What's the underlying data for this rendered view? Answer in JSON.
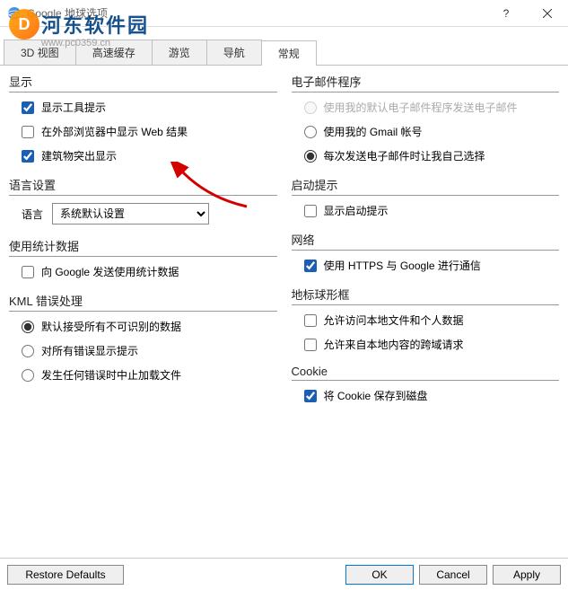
{
  "window": {
    "title": "Google 地球选项"
  },
  "watermark": {
    "text": "河东软件园",
    "url": "www.pc0359.cn",
    "logo": "D"
  },
  "tabs": [
    "3D 视图",
    "高速缓存",
    "游览",
    "导航",
    "常规"
  ],
  "active_tab": 4,
  "left": {
    "display": {
      "title": "显示",
      "items": [
        {
          "label": "显示工具提示",
          "checked": true
        },
        {
          "label": "在外部浏览器中显示 Web 结果",
          "checked": false
        },
        {
          "label": "建筑物突出显示",
          "checked": true
        }
      ]
    },
    "language": {
      "title": "语言设置",
      "label": "语言",
      "value": "系统默认设置"
    },
    "stats": {
      "title": "使用统计数据",
      "item": {
        "label": "向 Google 发送使用统计数据",
        "checked": false
      }
    },
    "kml": {
      "title": "KML 错误处理",
      "items": [
        {
          "label": "默认接受所有不可识别的数据"
        },
        {
          "label": "对所有错误显示提示"
        },
        {
          "label": "发生任何错误时中止加载文件"
        }
      ],
      "selected": 0
    }
  },
  "right": {
    "email": {
      "title": "电子邮件程序",
      "items": [
        {
          "label": "使用我的默认电子邮件程序发送电子邮件",
          "disabled": true
        },
        {
          "label": "使用我的 Gmail 帐号"
        },
        {
          "label": "每次发送电子邮件时让我自己选择"
        }
      ],
      "selected": 2
    },
    "startup": {
      "title": "启动提示",
      "item": {
        "label": "显示启动提示",
        "checked": false
      }
    },
    "network": {
      "title": "网络",
      "item": {
        "label": "使用 HTTPS 与 Google 进行通信",
        "checked": true
      }
    },
    "globe": {
      "title": "地标球形框",
      "items": [
        {
          "label": "允许访问本地文件和个人数据",
          "checked": false
        },
        {
          "label": "允许来自本地内容的跨域请求",
          "checked": false
        }
      ]
    },
    "cookie": {
      "title": "Cookie",
      "item": {
        "label": "将 Cookie 保存到磁盘",
        "checked": true
      }
    }
  },
  "footer": {
    "restore": "Restore Defaults",
    "ok": "OK",
    "cancel": "Cancel",
    "apply": "Apply"
  }
}
